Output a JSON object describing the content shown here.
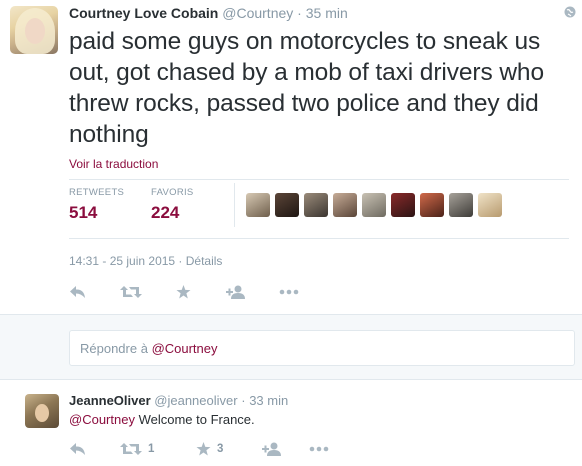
{
  "colors": {
    "accent": "#8b0d3e",
    "muted": "#8899a6",
    "icon": "#aab8c2",
    "text": "#292f33"
  },
  "main_tweet": {
    "author_name": "Courtney Love Cobain",
    "author_handle": "@Courtney",
    "dot": "·",
    "time": "35 min",
    "text": "paid some guys on motorcycles to sneak us out, got chased by a mob of taxi drivers who threw rocks,  passed two police and they did nothing",
    "translate_link": "Voir la traduction",
    "stats": {
      "retweets_label": "RETWEETS",
      "retweets_value": "514",
      "favorites_label": "FAVORIS",
      "favorites_value": "224"
    },
    "favoriters_count": 9,
    "datetime": "14:31 - 25 juin 2015 · Détails",
    "icons": [
      "globe-icon",
      "reply-icon",
      "retweet-icon",
      "favorite-icon",
      "follow-icon",
      "more-icon"
    ]
  },
  "reply_box": {
    "prefix": "Répondre à ",
    "mention": "@Courtney"
  },
  "reply_tweet": {
    "author_name": "JeanneOliver",
    "author_handle": "@jeanneoliver",
    "dot": "·",
    "time": "33 min",
    "mention": "@Courtney",
    "text": " Welcome to France.",
    "retweet_count": "1",
    "favorite_count": "3"
  }
}
